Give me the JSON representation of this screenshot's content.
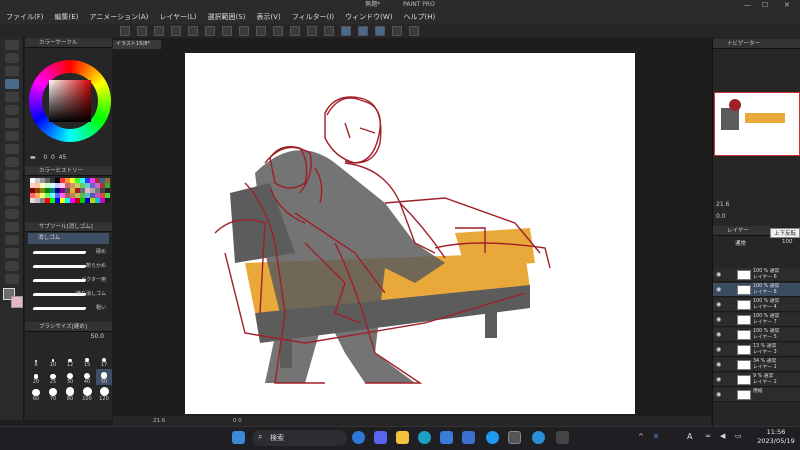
{
  "window": {
    "title": "無題*",
    "app_suffix": "PAINT PRO",
    "minimize": "—",
    "maximize": "☐",
    "close": "✕"
  },
  "menu": [
    "ファイル(F)",
    "編集(E)",
    "アニメーション(A)",
    "レイヤー(L)",
    "選択範囲(S)",
    "表示(V)",
    "フィルター(I)",
    "ウィンドウ(W)",
    "ヘルプ(H)"
  ],
  "canvas_tab": "イラスト15(8*",
  "panels": {
    "color_circle": "カラーサークル",
    "color_history": "カラーヒストリー",
    "subtool": "サブツール[消しゴム]",
    "brush_size": "ブラシサイズ[硬め]",
    "navigator": "ナビゲーター",
    "layer": "レイヤー"
  },
  "color_values": {
    "h": "0",
    "s": "0",
    "v": "45"
  },
  "subtool_items": {
    "selected": "消しゴム",
    "strokes": [
      {
        "label": "硬め"
      },
      {
        "label": "軟らかめ"
      },
      {
        "label": "ベクター用"
      },
      {
        "label": "練り消しゴム"
      },
      {
        "label": "粗い"
      }
    ]
  },
  "brush_size_value": "50.0",
  "brush_sizes": [
    "8",
    "10",
    "12",
    "15",
    "17",
    "20",
    "25",
    "30",
    "40",
    "50",
    "60",
    "70",
    "80",
    "100",
    "120"
  ],
  "navigator": {
    "zoom": "21.6",
    "angle": "0.0"
  },
  "tooltip": "上下反転",
  "layers": [
    {
      "line1": "100 % 通常",
      "line2": "レイヤー 6",
      "selected": false
    },
    {
      "line1": "100 % 通常",
      "line2": "レイヤー 8",
      "selected": true
    },
    {
      "line1": "100 % 通常",
      "line2": "レイヤー 4",
      "selected": false
    },
    {
      "line1": "100 % 通常",
      "line2": "レイヤー 7",
      "selected": false
    },
    {
      "line1": "100 % 通常",
      "line2": "レイヤー 5",
      "selected": false
    },
    {
      "line1": "13 % 通常",
      "line2": "レイヤー 3",
      "selected": false
    },
    {
      "line1": "34 % 通常",
      "line2": "レイヤー 1",
      "selected": false
    },
    {
      "line1": "9 % 通常",
      "line2": "レイヤー 2",
      "selected": false
    },
    {
      "line1": "用紙",
      "line2": "",
      "selected": false
    }
  ],
  "layer_blend": "通常",
  "layer_opacity": "100",
  "status": {
    "zoom": "21.6",
    "angle": "0.0"
  },
  "taskbar": {
    "search": "検索",
    "time": "11:56",
    "date": "2023/05/19",
    "ime": "A"
  },
  "colors": {
    "accent": "#4a6a8c",
    "sketch": "#a0202a",
    "couch": "#e8a83a",
    "fill": "#5c5c5c",
    "main_color": "#6d6d6d",
    "sub_color": "#e6b3c8"
  }
}
